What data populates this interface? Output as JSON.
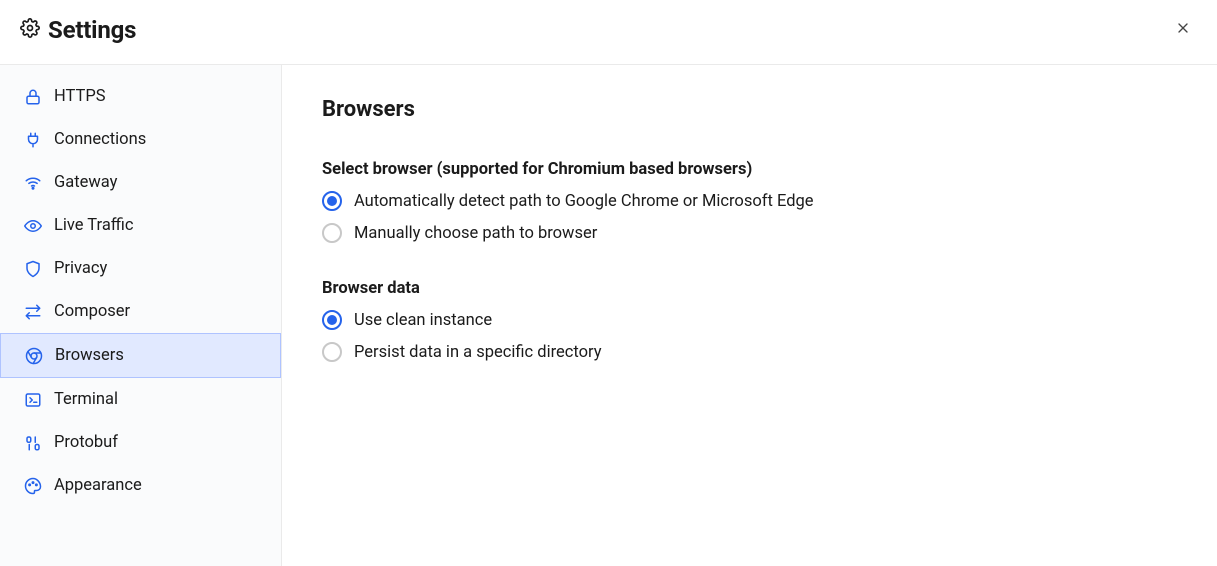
{
  "header": {
    "title": "Settings"
  },
  "sidebar": {
    "items": [
      {
        "id": "https",
        "label": "HTTPS",
        "icon": "lock-icon"
      },
      {
        "id": "connections",
        "label": "Connections",
        "icon": "plug-icon"
      },
      {
        "id": "gateway",
        "label": "Gateway",
        "icon": "wifi-icon"
      },
      {
        "id": "live-traffic",
        "label": "Live Traffic",
        "icon": "eye-icon"
      },
      {
        "id": "privacy",
        "label": "Privacy",
        "icon": "shield-icon"
      },
      {
        "id": "composer",
        "label": "Composer",
        "icon": "swap-icon"
      },
      {
        "id": "browsers",
        "label": "Browsers",
        "icon": "chrome-icon"
      },
      {
        "id": "terminal",
        "label": "Terminal",
        "icon": "terminal-icon"
      },
      {
        "id": "protobuf",
        "label": "Protobuf",
        "icon": "binary-icon"
      },
      {
        "id": "appearance",
        "label": "Appearance",
        "icon": "palette-icon"
      }
    ],
    "active": "browsers"
  },
  "main": {
    "heading": "Browsers",
    "sections": [
      {
        "id": "select-browser",
        "label": "Select browser (supported for Chromium based browsers)",
        "options": [
          {
            "id": "auto-detect",
            "label": "Automatically detect path to Google Chrome or Microsoft Edge",
            "selected": true
          },
          {
            "id": "manual-path",
            "label": "Manually choose path to browser",
            "selected": false
          }
        ]
      },
      {
        "id": "browser-data",
        "label": "Browser data",
        "options": [
          {
            "id": "clean-instance",
            "label": "Use clean instance",
            "selected": true
          },
          {
            "id": "persist-dir",
            "label": "Persist data in a specific directory",
            "selected": false
          }
        ]
      }
    ]
  }
}
